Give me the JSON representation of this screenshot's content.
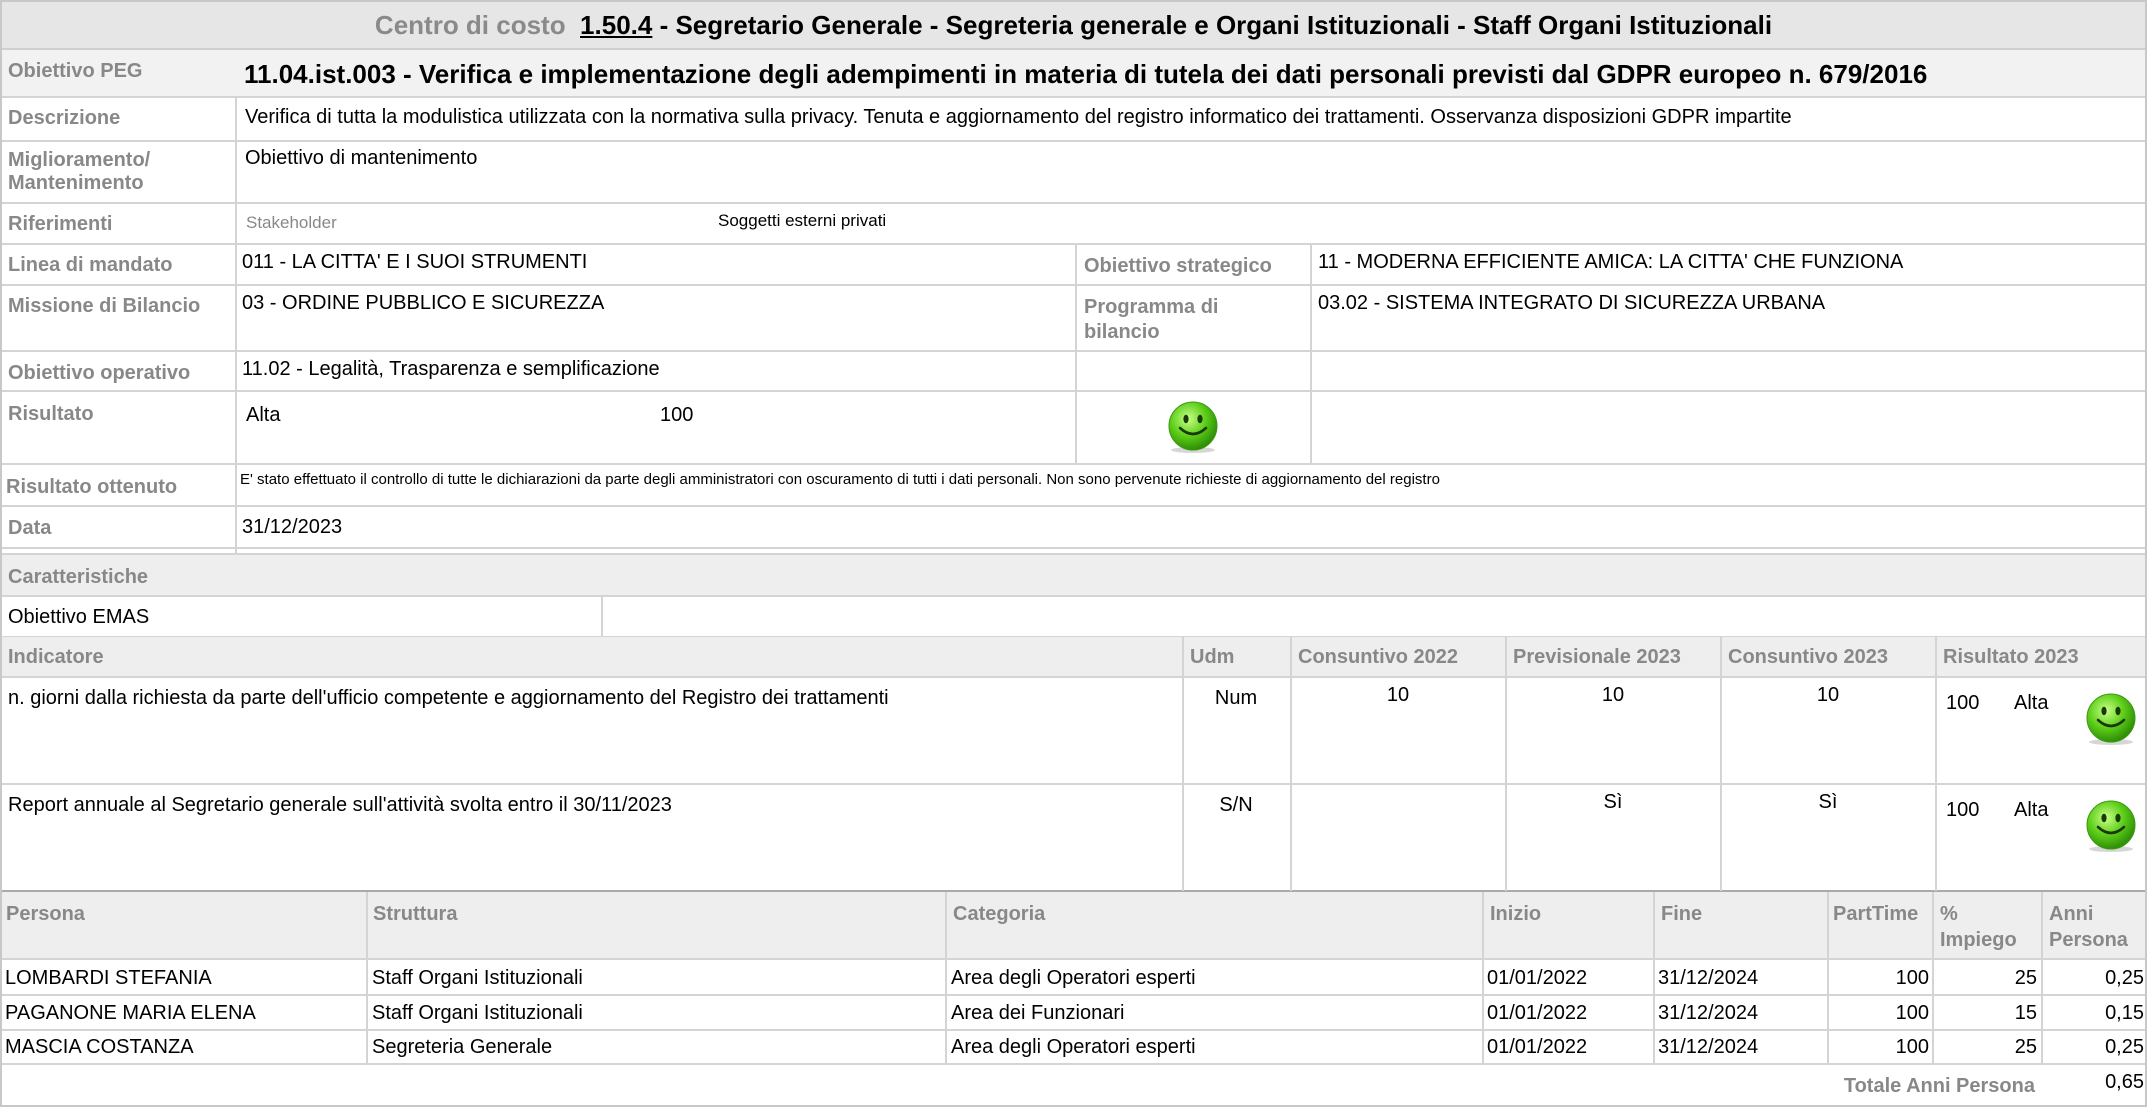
{
  "header": {
    "prefix": "Centro di costo",
    "code": "1.50.4",
    "rest": "- Segretario Generale - Segreteria generale e Organi Istituzionali - Staff Organi Istituzionali"
  },
  "peg": {
    "label": "Obiettivo PEG",
    "value": "11.04.ist.003 - Verifica e implementazione degli adempimenti in materia di tutela dei dati personali previsti dal GDPR europeo n. 679/2016"
  },
  "descrizione": {
    "label": "Descrizione",
    "value": "Verifica di tutta la modulistica utilizzata con la normativa sulla privacy. Tenuta e aggiornamento del registro informatico dei trattamenti. Osservanza disposizioni GDPR impartite"
  },
  "miglioramento": {
    "label_line1": "Miglioramento/",
    "label_line2": "Mantenimento",
    "value": "Obiettivo di mantenimento"
  },
  "riferimenti": {
    "label": "Riferimenti",
    "stakeholder_label": "Stakeholder",
    "stakeholder_value": "Soggetti esterni privati"
  },
  "linea": {
    "label": "Linea di mandato",
    "value": "011 - LA CITTA' E I SUOI STRUMENTI"
  },
  "obiettivo_strategico": {
    "label": "Obiettivo strategico",
    "value": "11 - MODERNA EFFICIENTE AMICA: LA CITTA' CHE FUNZIONA"
  },
  "missione": {
    "label": "Missione di Bilancio",
    "value": "03 - ORDINE PUBBLICO E SICUREZZA"
  },
  "programma": {
    "label_line1": "Programma di",
    "label_line2": "bilancio",
    "value": "03.02 - SISTEMA INTEGRATO DI SICUREZZA URBANA"
  },
  "operativo": {
    "label": "Obiettivo operativo",
    "value": "11.02 - Legalità, Trasparenza e semplificazione"
  },
  "risultato": {
    "label": "Risultato",
    "level": "Alta",
    "score": "100"
  },
  "risultato_ottenuto": {
    "label": "Risultato ottenuto",
    "value": "E' stato effettuato il controllo di tutte le dichiarazioni da parte degli amministratori con oscuramento di tutti i dati personali. Non sono pervenute richieste di aggiornamento del registro"
  },
  "data": {
    "label": "Data",
    "value": "31/12/2023"
  },
  "caratteristiche": {
    "label": "Caratteristiche",
    "emas": "Obiettivo EMAS"
  },
  "indicatori": {
    "headers": {
      "indicatore": "Indicatore",
      "udm": "Udm",
      "c2022": "Consuntivo 2022",
      "p2023": "Previsionale 2023",
      "c2023": "Consuntivo 2023",
      "r2023": "Risultato 2023"
    },
    "rows": [
      {
        "name": "n. giorni dalla richiesta da parte dell'ufficio competente e aggiornamento del Registro dei trattamenti",
        "udm": "Num",
        "c2022": "10",
        "p2023": "10",
        "c2023": "10",
        "score": "100",
        "level": "Alta"
      },
      {
        "name": "Report annuale al Segretario generale sull'attività svolta entro il 30/11/2023",
        "udm": "S/N",
        "c2022": "",
        "p2023": "Sì",
        "c2023": "Sì",
        "score": "100",
        "level": "Alta"
      }
    ]
  },
  "persone": {
    "headers": {
      "persona": "Persona",
      "struttura": "Struttura",
      "categoria": "Categoria",
      "inizio": "Inizio",
      "fine": "Fine",
      "parttime": "PartTime",
      "impiego_line1": "%",
      "impiego_line2": "Impiego",
      "anni_line1": "Anni",
      "anni_line2": "Persona"
    },
    "rows": [
      {
        "persona": "LOMBARDI STEFANIA",
        "struttura": "Staff Organi Istituzionali",
        "categoria": "Area degli Operatori esperti",
        "inizio": "01/01/2022",
        "fine": "31/12/2024",
        "parttime": "100",
        "impiego": "25",
        "anni": "0,25"
      },
      {
        "persona": "PAGANONE MARIA ELENA",
        "struttura": "Staff Organi Istituzionali",
        "categoria": "Area dei Funzionari",
        "inizio": "01/01/2022",
        "fine": "31/12/2024",
        "parttime": "100",
        "impiego": "15",
        "anni": "0,15"
      },
      {
        "persona": "MASCIA COSTANZA",
        "struttura": "Segreteria Generale",
        "categoria": "Area degli Operatori esperti",
        "inizio": "01/01/2022",
        "fine": "31/12/2024",
        "parttime": "100",
        "impiego": "25",
        "anni": "0,25"
      }
    ],
    "totale_label": "Totale Anni Persona",
    "totale_value": "0,65"
  },
  "colors": {
    "label_gray": "#888888",
    "header_bg": "#e8e8e8",
    "border": "#d4d4d4",
    "smiley": "#5fcf1a"
  }
}
